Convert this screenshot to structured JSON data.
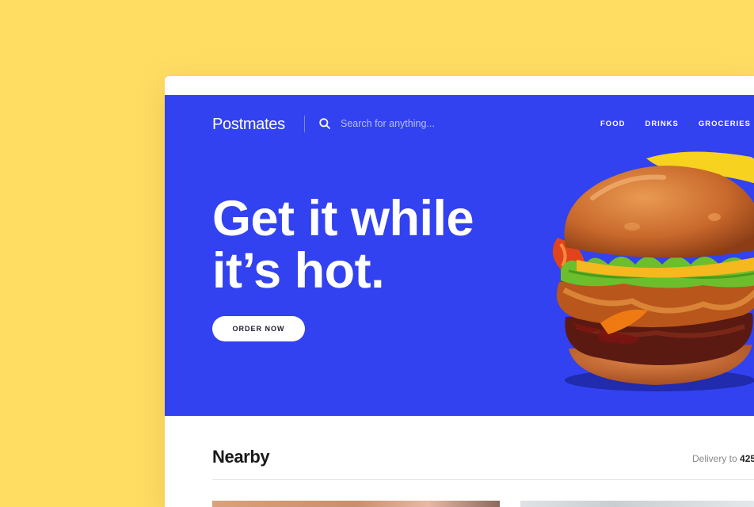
{
  "header": {
    "logo": "Postmates",
    "search_placeholder": "Search for anything...",
    "nav": [
      "FOOD",
      "DRINKS",
      "GROCERIES"
    ]
  },
  "hero": {
    "headline_line1": "Get it while",
    "headline_line2": "it’s hot.",
    "cta_label": "ORDER NOW"
  },
  "nearby": {
    "title": "Nearby",
    "delivery_label": "Delivery to",
    "delivery_zip": "425"
  },
  "colors": {
    "background": "#FFDD63",
    "hero": "#3242F0",
    "button_text": "#1a1a2e"
  },
  "icons": {
    "search": "search-icon"
  }
}
